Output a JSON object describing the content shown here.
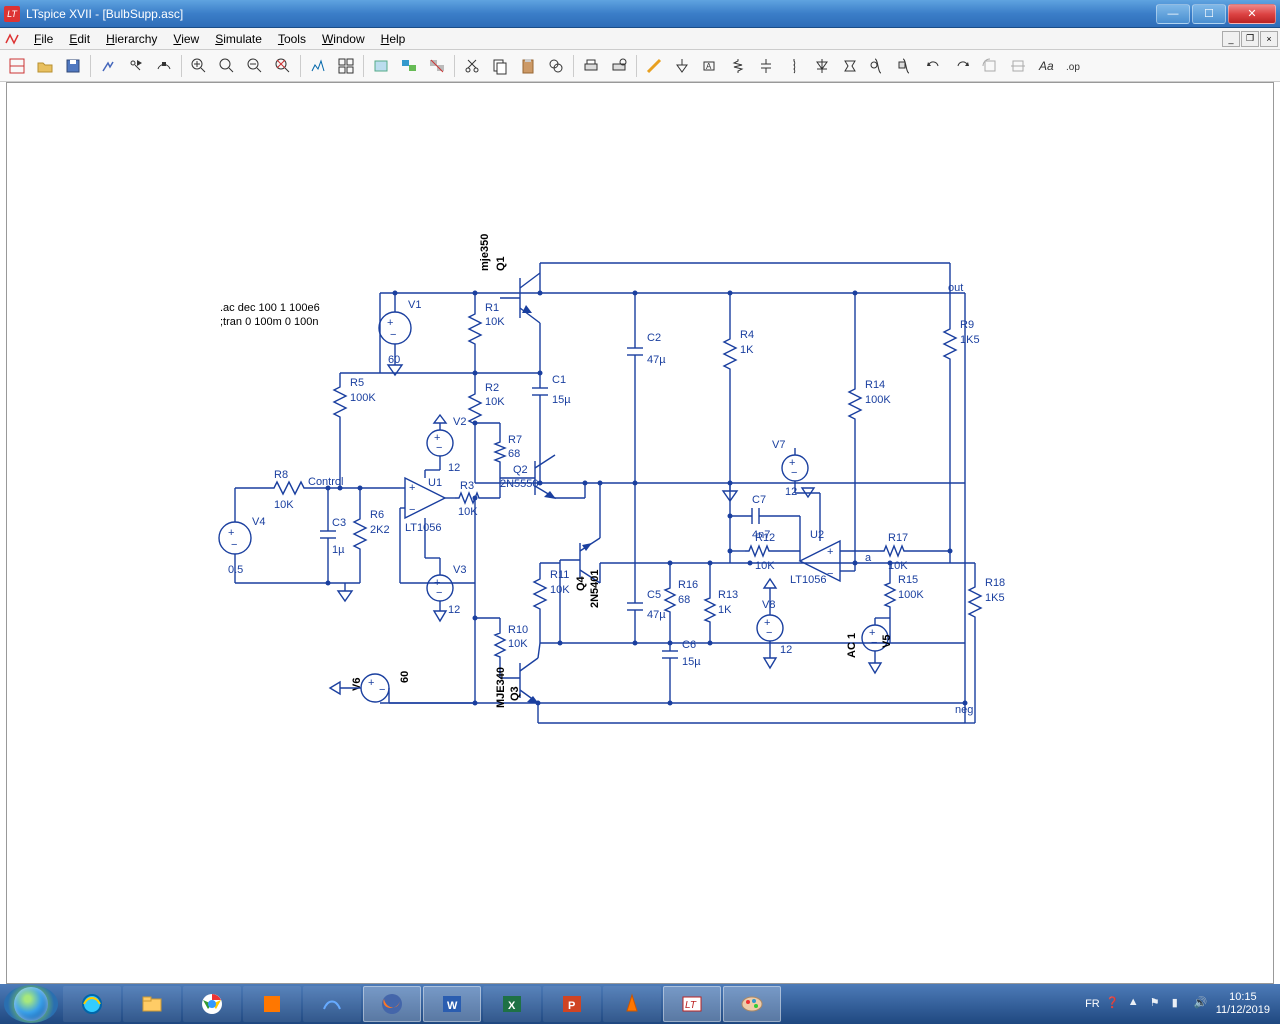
{
  "window": {
    "title": "LTspice XVII - [BulbSupp.asc]"
  },
  "menu": {
    "file": "File",
    "edit": "Edit",
    "hierarchy": "Hierarchy",
    "view": "View",
    "simulate": "Simulate",
    "tools": "Tools",
    "window": "Window",
    "help": "Help"
  },
  "directives": {
    "ac": ".ac dec 100 1 100e6",
    "tran": ";tran 0 100m 0 100n"
  },
  "nets": {
    "control": "Control",
    "out": "out",
    "neg": "neg",
    "a": "a"
  },
  "components": {
    "V1": {
      "name": "V1",
      "value": "60"
    },
    "V2": {
      "name": "V2",
      "value": "12"
    },
    "V3": {
      "name": "V3",
      "value": "12"
    },
    "V4": {
      "name": "V4",
      "value": "0.5"
    },
    "V5": {
      "name": "V5",
      "value": ""
    },
    "V6": {
      "name": "V6",
      "value": "60"
    },
    "V7": {
      "name": "V7",
      "value": "12"
    },
    "V8": {
      "name": "V8",
      "value": "12"
    },
    "R1": {
      "name": "R1",
      "value": "10K"
    },
    "R2": {
      "name": "R2",
      "value": "10K"
    },
    "R3": {
      "name": "R3",
      "value": "10K"
    },
    "R4": {
      "name": "R4",
      "value": "1K"
    },
    "R5": {
      "name": "R5",
      "value": "100K"
    },
    "R6": {
      "name": "R6",
      "value": "2K2"
    },
    "R7": {
      "name": "R7",
      "value": "68"
    },
    "R8": {
      "name": "R8",
      "value": "10K"
    },
    "R9": {
      "name": "R9",
      "value": "1K5"
    },
    "R10": {
      "name": "R10",
      "value": "10K"
    },
    "R11": {
      "name": "R11",
      "value": "10K"
    },
    "R12": {
      "name": "R12",
      "value": "10K"
    },
    "R13": {
      "name": "R13",
      "value": "1K"
    },
    "R14": {
      "name": "R14",
      "value": "100K"
    },
    "R15": {
      "name": "R15",
      "value": "100K"
    },
    "R16": {
      "name": "R16",
      "value": "68"
    },
    "R17": {
      "name": "R17",
      "value": "10K"
    },
    "R18": {
      "name": "R18",
      "value": "1K5"
    },
    "C1": {
      "name": "C1",
      "value": "15µ"
    },
    "C2": {
      "name": "C2",
      "value": "47µ"
    },
    "C3": {
      "name": "C3",
      "value": "1µ"
    },
    "C5": {
      "name": "C5",
      "value": "47µ"
    },
    "C6": {
      "name": "C6",
      "value": "15µ"
    },
    "C7": {
      "name": "C7",
      "value": "4n7"
    },
    "U1": {
      "name": "U1",
      "model": "LT1056"
    },
    "U2": {
      "name": "U2",
      "model": "LT1056"
    },
    "Q1": {
      "name": "Q1",
      "model": "mje350"
    },
    "Q2": {
      "name": "Q2",
      "model": "2N5550"
    },
    "Q3": {
      "name": "Q3",
      "model": "MJE340"
    },
    "Q4": {
      "name": "Q4",
      "model": "2N5401"
    },
    "AC1": {
      "name": "AC 1"
    }
  },
  "tray": {
    "lang": "FR",
    "time": "10:15",
    "date": "11/12/2019"
  }
}
